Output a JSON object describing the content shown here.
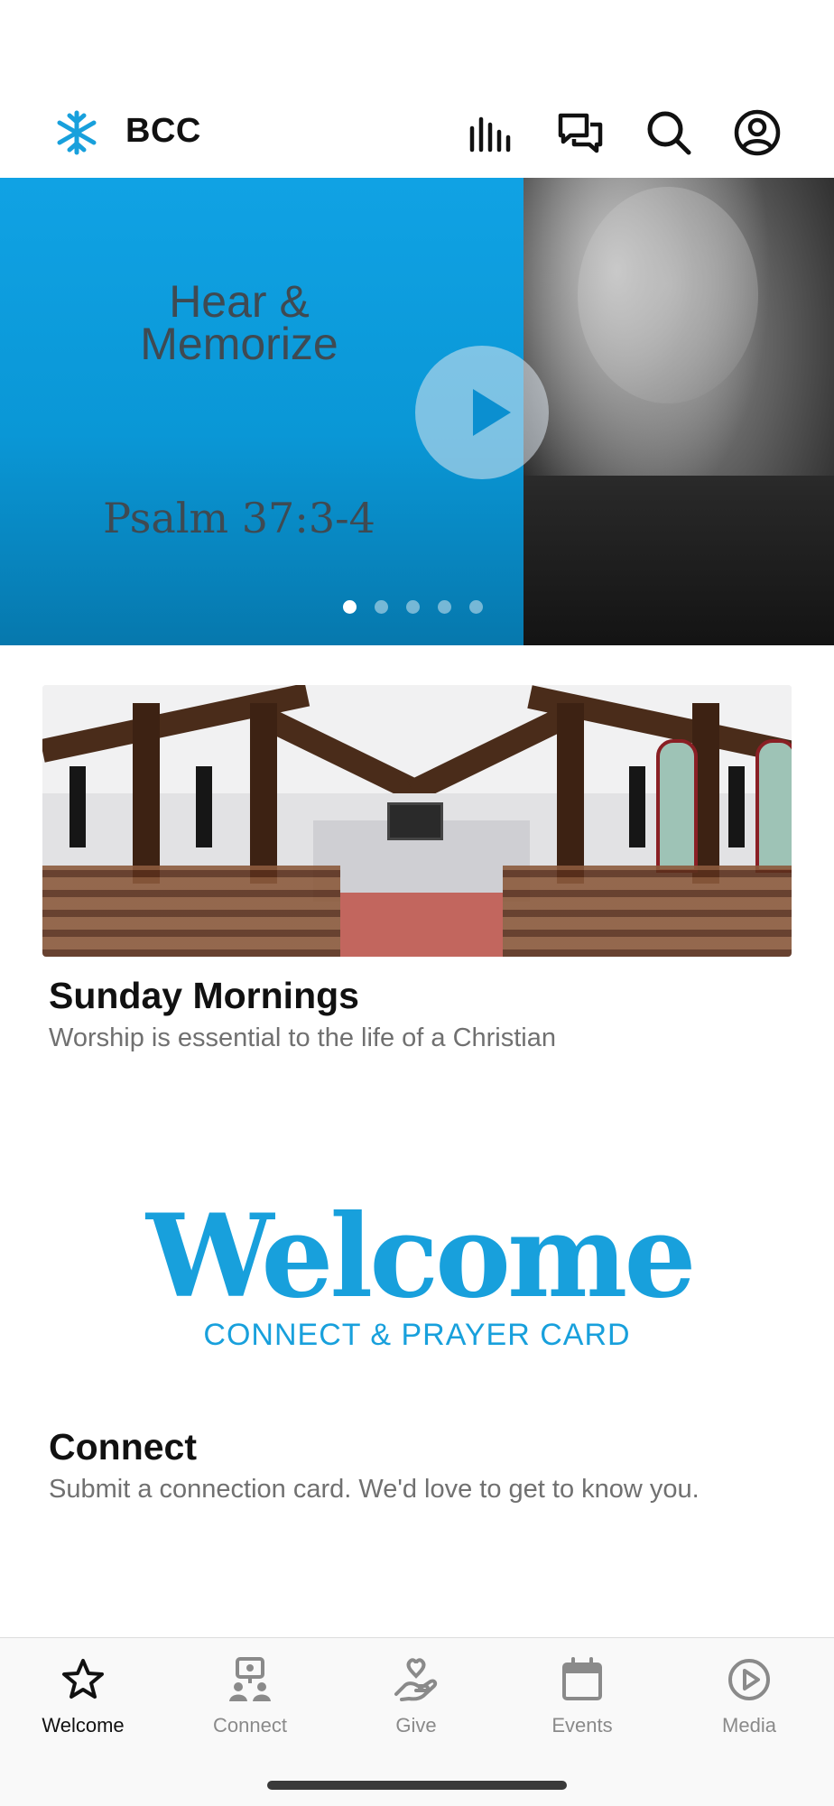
{
  "header": {
    "title": "BCC",
    "logo_icon": "snowflake-logo-icon",
    "icons": [
      "live-audio-icon",
      "chat-icon",
      "search-icon",
      "profile-icon"
    ],
    "brand_color": "#18a0dc"
  },
  "hero": {
    "title_line1": "Hear &",
    "title_line2": "Memorize",
    "verse": "Psalm 37:3-4",
    "slide_count": 5,
    "active_slide": 1
  },
  "cards": [
    {
      "title": "Sunday Mornings",
      "subtitle": "Worship is essential to the life of a Christian"
    },
    {
      "title": "Connect",
      "subtitle": "Submit a connection card. We'd love to get to know you."
    }
  ],
  "welcome_graphic": {
    "headline": "Welcome",
    "subline": "CONNECT & PRAYER CARD"
  },
  "tabs": [
    {
      "label": "Welcome",
      "icon": "star-icon",
      "active": true
    },
    {
      "label": "Connect",
      "icon": "connect-people-icon",
      "active": false
    },
    {
      "label": "Give",
      "icon": "give-hand-heart-icon",
      "active": false
    },
    {
      "label": "Events",
      "icon": "calendar-icon",
      "active": false
    },
    {
      "label": "Media",
      "icon": "play-circle-icon",
      "active": false
    }
  ]
}
